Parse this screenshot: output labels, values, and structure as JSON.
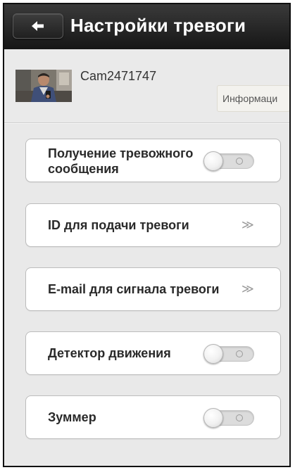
{
  "header": {
    "title": "Настройки тревоги",
    "back_icon": "back-arrow-icon"
  },
  "device": {
    "name": "Cam2471747",
    "info_button_label": "Информаци"
  },
  "settings": {
    "alarm_message": {
      "label": "Получение тревожного сообщения",
      "enabled": false
    },
    "alarm_id": {
      "label": "ID для подачи тревоги",
      "icon": "double-chevron-right-icon"
    },
    "alarm_email": {
      "label": "E-mail для сигнала тревоги",
      "icon": "double-chevron-right-icon"
    },
    "motion_detector": {
      "label": "Детектор движения",
      "enabled": false
    },
    "buzzer": {
      "label": "Зуммер",
      "enabled": false
    }
  },
  "colors": {
    "header": "#1c1c1c",
    "background": "#e9e9e9",
    "card": "#ffffff"
  }
}
